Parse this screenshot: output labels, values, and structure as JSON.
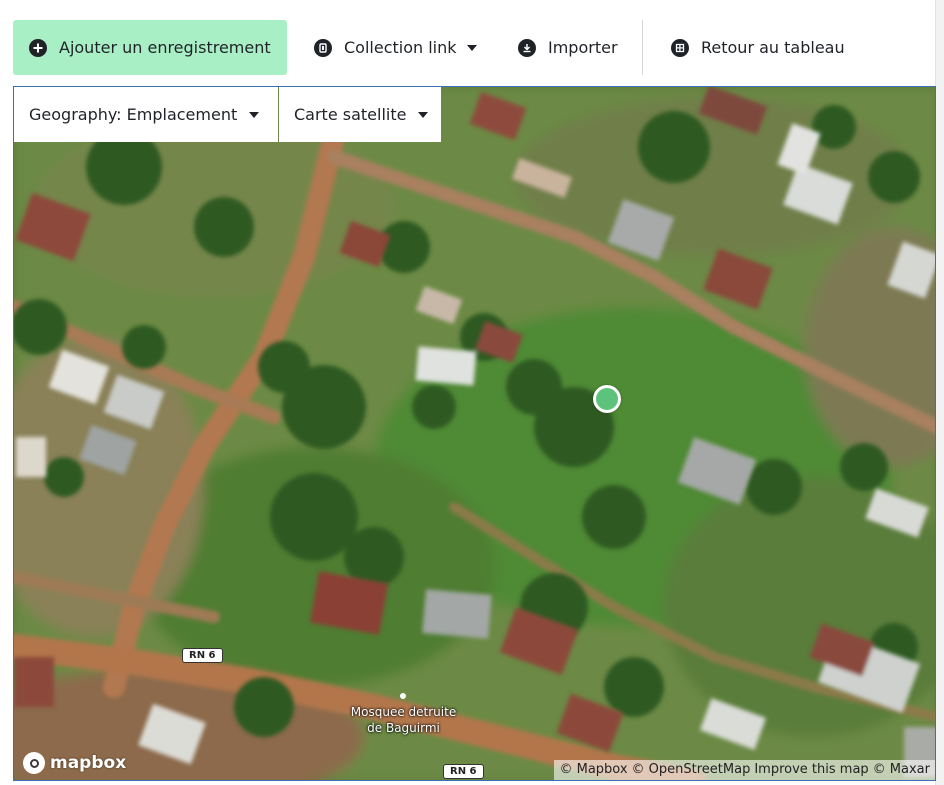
{
  "toolbar": {
    "add_record": {
      "label": "Ajouter un enregistrement",
      "icon": "plus-circle-icon"
    },
    "collection_link": {
      "label": "Collection link",
      "icon": "link-square-icon"
    },
    "import": {
      "label": "Importer",
      "icon": "download-circle-icon"
    },
    "back_to_table": {
      "label": "Retour au tableau",
      "icon": "table-icon"
    }
  },
  "map": {
    "geography_selector": {
      "label": "Geography: Emplacement"
    },
    "layer_selector": {
      "label": "Carte satellite"
    },
    "road_labels": [
      "RN 6",
      "RN 6"
    ],
    "poi": {
      "name_line1": "Mosquee detruite",
      "name_line2": "de Baguirmi"
    },
    "logo": "mapbox",
    "attribution": {
      "mapbox": "© Mapbox",
      "osm": "© OpenStreetMap",
      "improve": "Improve this map",
      "maxar": "© Maxar"
    },
    "marker_color": "#5dc37c"
  },
  "colors": {
    "accent": "#a9efc6",
    "text": "#1f2328",
    "map_border": "#3b6fb6"
  }
}
